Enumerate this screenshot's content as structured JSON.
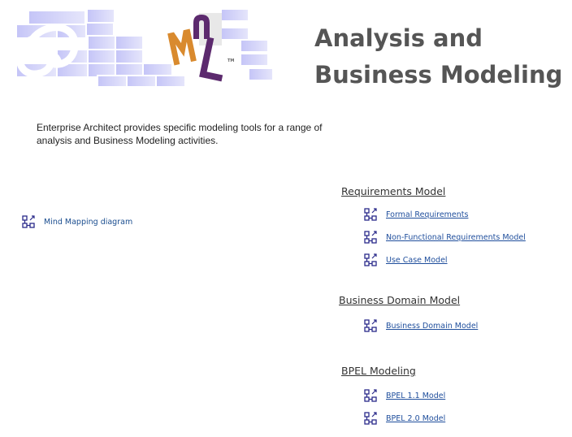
{
  "page": {
    "title_line1": "Analysis and",
    "title_line2": "Business Modeling",
    "intro": "Enterprise Architect provides specific modeling tools for a range of analysis and Business Modeling activities."
  },
  "logo": {
    "uml_letters": [
      "U",
      "M",
      "L"
    ],
    "tm": "TM"
  },
  "left_links": [
    {
      "label": "Mind Mapping diagram",
      "icon": "diagram-link-icon"
    }
  ],
  "sections": [
    {
      "heading": "Requirements Model",
      "items": [
        {
          "label": "Formal Requirements",
          "icon": "diagram-link-icon"
        },
        {
          "label": "Non-Functional Requirements Model",
          "icon": "diagram-link-icon"
        },
        {
          "label": "Use Case Model",
          "icon": "diagram-link-icon"
        }
      ]
    },
    {
      "heading": "Business Domain Model",
      "items": [
        {
          "label": "Business Domain Model",
          "icon": "diagram-link-icon"
        }
      ]
    },
    {
      "heading": "BPEL Modeling",
      "items": [
        {
          "label": "BPEL 1.1 Model",
          "icon": "diagram-link-icon"
        },
        {
          "label": "BPEL 2.0 Model",
          "icon": "diagram-link-icon"
        }
      ]
    }
  ],
  "colors": {
    "brick": "#c9c9f5",
    "brick_edge": "#ffffff",
    "uml_orange": "#d98a2e",
    "uml_purple": "#5c2a6e",
    "title": "#555555",
    "link": "#1f4e9c"
  }
}
